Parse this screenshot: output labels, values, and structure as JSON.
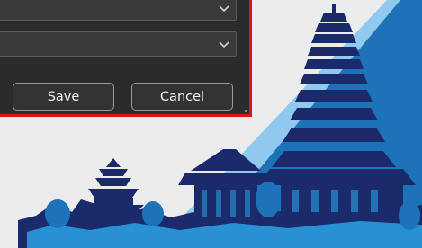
{
  "dialog": {
    "dropdown_1": {
      "value": ""
    },
    "dropdown_2": {
      "value": ""
    },
    "save_label": "Save",
    "cancel_label": "Cancel"
  },
  "icons": [
    "chevron-down-icon",
    "resize-grip-icon"
  ],
  "colors": {
    "dialog_background": "#2b2b2b",
    "dialog_border": "#e3111c",
    "wallpaper_blue": "#1e73b8",
    "wallpaper_navy": "#1a2a6b",
    "wallpaper_light_blue": "#2aa3e6"
  }
}
